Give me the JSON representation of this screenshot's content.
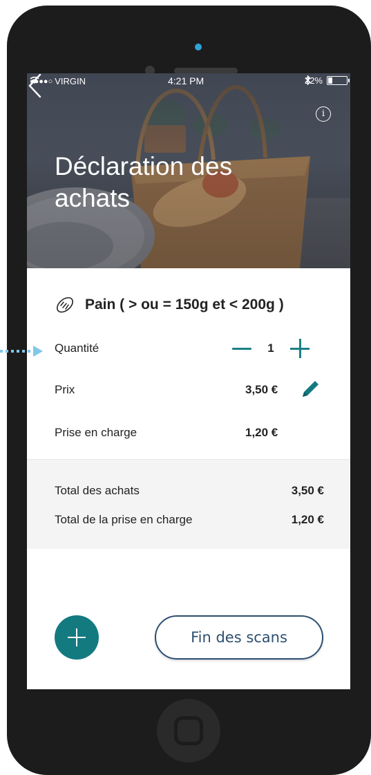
{
  "status_bar": {
    "signal": "●●●●○",
    "carrier": "VIRGIN",
    "time": "4:21 PM",
    "battery_text": "22%",
    "battery_level": 0.22
  },
  "header": {
    "title": "Déclaration des achats"
  },
  "product": {
    "name": "Pain ( > ou = 150g et < 200g )"
  },
  "quantity": {
    "label": "Quantité",
    "value": "1"
  },
  "price": {
    "label": "Prix",
    "value": "3,50 €"
  },
  "charge": {
    "label": "Prise en charge",
    "value": "1,20 €"
  },
  "totals": {
    "purchases_label": "Total des achats",
    "purchases_value": "3,50 €",
    "charge_label": "Total de la prise en charge",
    "charge_value": "1,20 €"
  },
  "actions": {
    "end_scans_label": "Fin des scans"
  },
  "colors": {
    "accent": "#137a80",
    "button_border": "#2c4f70",
    "callout": "#7ec8e8"
  }
}
